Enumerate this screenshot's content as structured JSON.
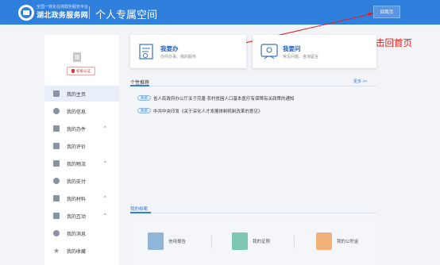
{
  "header": {
    "logo_sub": "全国一体化在线政务服务平台",
    "logo_main": "湖北政务服务网",
    "title": "个人专属空间",
    "home_button": "回首页"
  },
  "annotation": {
    "text": "登陆成功后点击回首页",
    "color": "#e02020"
  },
  "sidebar": {
    "verify_label": "初级认证",
    "items": [
      {
        "label": "我的主页",
        "icon": "home-icon",
        "active": true,
        "caret": ""
      },
      {
        "label": "我的信息",
        "icon": "info-icon",
        "caret": ""
      },
      {
        "label": "我的办件",
        "icon": "document-icon",
        "caret": "^"
      },
      {
        "label": "我的评价",
        "icon": "rating-icon",
        "caret": ""
      },
      {
        "label": "我的物流",
        "icon": "logistics-icon",
        "caret": "^"
      },
      {
        "label": "我的支付",
        "icon": "payment-icon",
        "caret": ""
      },
      {
        "label": "我的材料",
        "icon": "materials-icon",
        "caret": "^"
      },
      {
        "label": "我的互动",
        "icon": "interaction-icon",
        "caret": "^"
      },
      {
        "label": "我的消息",
        "icon": "bell-icon",
        "caret": ""
      },
      {
        "label": "我的收藏",
        "icon": "star-icon",
        "caret": ""
      }
    ]
  },
  "cards": [
    {
      "title": "我要办",
      "desc": "办件办事、我的服务",
      "icon": "handle-affairs-icon"
    },
    {
      "title": "我要问",
      "desc": "常见问题、咨询留言",
      "icon": "consult-icon"
    }
  ],
  "personalized": {
    "title": "个性推荐",
    "more": "更多 >>",
    "items": [
      {
        "tag": "政策",
        "text": "省人民政府办公厅关于完善 农村贫困人口基本医疗有保障有关政策的通知"
      },
      {
        "tag": "政策",
        "text": "中共中央印发《关于深化人才发展体制机制改革的意见》"
      }
    ]
  },
  "archive": {
    "title": "我的档案",
    "items": [
      {
        "label": "信用报告",
        "icon": "credit-report-icon",
        "color": "#8fb6d9"
      },
      {
        "label": "我的证照",
        "icon": "license-icon",
        "color": "#7dc6b0"
      },
      {
        "label": "我的公积金",
        "icon": "housing-fund-icon",
        "color": "#f0b27a"
      }
    ]
  },
  "colors": {
    "header": "#2f7fdd",
    "accent": "#2c5fb0"
  }
}
